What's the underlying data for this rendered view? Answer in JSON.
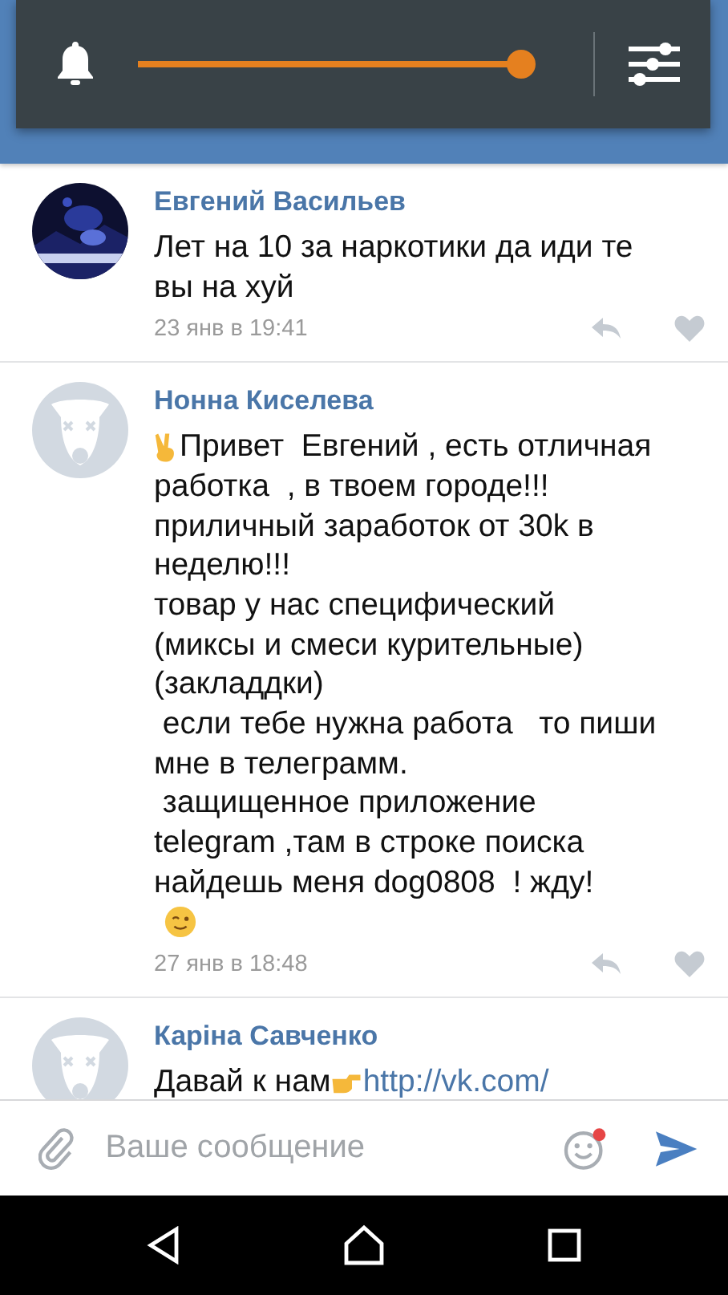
{
  "volume_panel": {
    "level": 1
  },
  "comments": [
    {
      "author": "Евгений Васильев",
      "avatar": {
        "kind": "picture"
      },
      "lines": [
        {
          "text": "Лет на 10 за наркотики да иди те"
        },
        {
          "text": "вы на хуй"
        }
      ],
      "date": "23 янв в 19:41"
    },
    {
      "author": "Нонна Киселева",
      "avatar": {
        "kind": "deleted"
      },
      "lines": [
        {
          "emoji": {
            "kind": "victory"
          },
          "text": "Привет  Евгений , есть отличная"
        },
        {
          "text": "работка  , в твоем городе!!!"
        },
        {
          "text": "приличный заработок от 30k в"
        },
        {
          "text": "неделю!!!"
        },
        {
          "text": "товар у нас специфический"
        },
        {
          "text": "(миксы и смеси курительные)"
        },
        {
          "text": "(закладдки)"
        },
        {
          "text": " если тебе нужна работа   то пиши"
        },
        {
          "text": "мне в телеграмм."
        },
        {
          "text": " защищенное приложение"
        },
        {
          "text": "telegram ,там в строке поиска"
        },
        {
          "text": "найдешь меня dog0808  ! жду!"
        },
        {
          "emoji": {
            "kind": "wink"
          }
        }
      ],
      "date": "27 янв в 18:48"
    },
    {
      "author": "Каріна Савченко",
      "avatar": {
        "kind": "deleted"
      },
      "lines": [
        {
          "text": "Давай к нам",
          "trail_emoji": {
            "kind": "pointing"
          },
          "link": "http://vk.com/"
        }
      ]
    }
  ],
  "composer": {
    "placeholder": "Ваше сообщение",
    "emoji_badge": true
  }
}
